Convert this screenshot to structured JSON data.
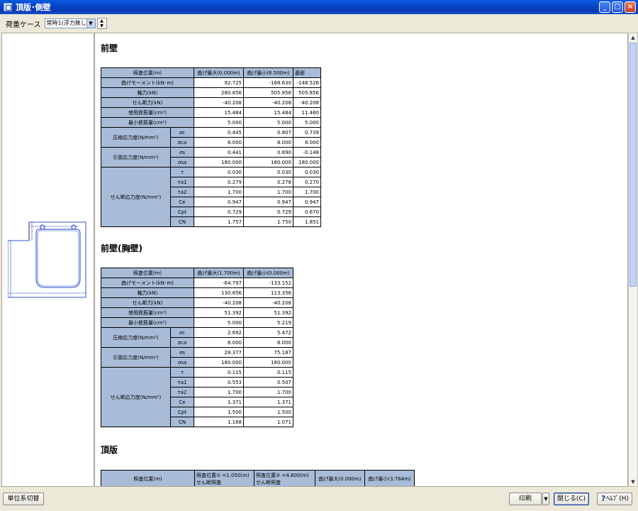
{
  "window": {
    "title": "頂版･側壁"
  },
  "toolbar": {
    "load_case_label": "荷重ケース",
    "load_case_value": "常時1(浮力無し)c"
  },
  "sections": [
    {
      "title": "前壁",
      "headers": [
        "照査位置(m)",
        "曲げ最大(0.000m)",
        "曲げ最小(6.500m)",
        "基部"
      ],
      "rows": [
        {
          "label": "曲げモーメント(kN･m)",
          "values": [
            "92.725",
            "-168.630",
            "-148.526"
          ]
        },
        {
          "label": "軸力(kN)",
          "values": [
            "280.856",
            "505.856",
            "505.856"
          ]
        },
        {
          "label": "せん断力(kN)",
          "values": [
            "-40.208",
            "-40.208",
            "-40.208"
          ]
        },
        {
          "label": "使用鉄筋量(cm²)",
          "values": [
            "15.484",
            "15.484",
            "11.460"
          ]
        },
        {
          "label": "最小鉄筋量(cm²)",
          "values": [
            "5.000",
            "5.000",
            "5.000"
          ]
        }
      ],
      "groups": [
        {
          "label": "圧縮応力度(N/mm²)",
          "rows": [
            {
              "sym": "σc",
              "values": [
                "0.445",
                "0.807",
                "0.739"
              ]
            },
            {
              "sym": "σca",
              "values": [
                "8.000",
                "8.000",
                "8.000"
              ]
            }
          ]
        },
        {
          "label": "引張応力度(N/mm²)",
          "rows": [
            {
              "sym": "σs",
              "values": [
                "0.441",
                "0.890",
                "-0.148"
              ]
            },
            {
              "sym": "σsa",
              "values": [
                "180.000",
                "180.000",
                "180.000"
              ]
            }
          ]
        },
        {
          "label": "せん断応力度(N/mm²)",
          "rows": [
            {
              "sym": "τ",
              "values": [
                "0.030",
                "0.030",
                "0.030"
              ]
            },
            {
              "sym": "τa1",
              "values": [
                "0.279",
                "0.278",
                "0.270"
              ]
            },
            {
              "sym": "τa2",
              "values": [
                "1.700",
                "1.700",
                "1.700"
              ]
            },
            {
              "sym": "Ce",
              "values": [
                "0.947",
                "0.947",
                "0.947"
              ]
            },
            {
              "sym": "Cpt",
              "values": [
                "0.729",
                "0.729",
                "0.670"
              ]
            },
            {
              "sym": "CN",
              "values": [
                "1.757",
                "1.750",
                "1.851"
              ]
            }
          ]
        }
      ]
    },
    {
      "title": "前壁(胸壁)",
      "headers": [
        "照査位置(m)",
        "曲げ最大(1.700m)",
        "曲げ最小(0.000m)"
      ],
      "rows": [
        {
          "label": "曲げモーメント(kN･m)",
          "values": [
            "-64.797",
            "-133.152"
          ]
        },
        {
          "label": "軸力(kN)",
          "values": [
            "130.856",
            "113.356"
          ]
        },
        {
          "label": "せん断力(kN)",
          "values": [
            "-40.208",
            "-40.208"
          ]
        },
        {
          "label": "使用鉄筋量(cm²)",
          "values": [
            "51.392",
            "51.392"
          ]
        },
        {
          "label": "最小鉄筋量(cm²)",
          "values": [
            "5.000",
            "5.219"
          ]
        }
      ],
      "groups": [
        {
          "label": "圧縮応力度(N/mm²)",
          "rows": [
            {
              "sym": "σc",
              "values": [
                "2.692",
                "5.472"
              ]
            },
            {
              "sym": "σca",
              "values": [
                "8.000",
                "8.000"
              ]
            }
          ]
        },
        {
          "label": "引張応力度(N/mm²)",
          "rows": [
            {
              "sym": "σs",
              "values": [
                "28.377",
                "75.187"
              ]
            },
            {
              "sym": "σsa",
              "values": [
                "180.000",
                "180.000"
              ]
            }
          ]
        },
        {
          "label": "せん断応力度(N/mm²)",
          "rows": [
            {
              "sym": "τ",
              "values": [
                "0.115",
                "0.115"
              ]
            },
            {
              "sym": "τa1",
              "values": [
                "0.553",
                "0.507"
              ]
            },
            {
              "sym": "τa2",
              "values": [
                "1.700",
                "1.700"
              ]
            },
            {
              "sym": "Ce",
              "values": [
                "1.371",
                "1.371"
              ]
            },
            {
              "sym": "Cpt",
              "values": [
                "1.500",
                "1.500"
              ]
            },
            {
              "sym": "CN",
              "values": [
                "1.168",
                "1.071"
              ]
            }
          ]
        }
      ]
    },
    {
      "title": "頂版",
      "headers": [
        "照査位置(m)",
        "照査位置① =1.050(m) せん断照査",
        "照査位置② =4.600(m) せん断照査",
        "曲げ最大(0.000m)",
        "曲げ最小(3.784m)"
      ]
    }
  ],
  "bottom": {
    "unit_switch_label": "単位系切替",
    "print_label": "印刷",
    "close_label": "閉じる(C)",
    "help_label": "ﾍﾙﾌﾟ(H)"
  }
}
